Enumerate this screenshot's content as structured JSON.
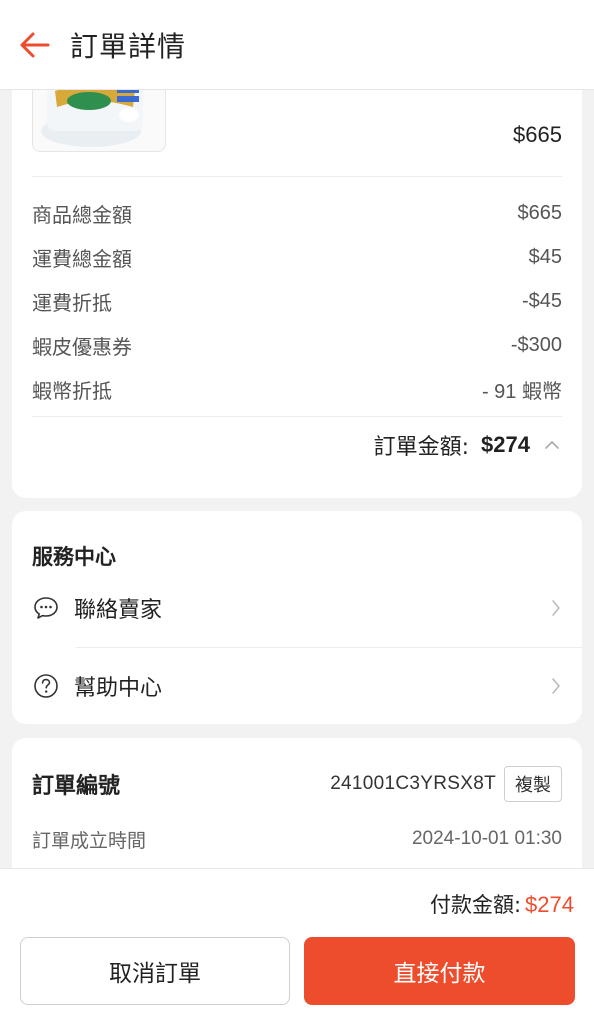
{
  "header": {
    "title": "訂單詳情"
  },
  "product": {
    "price": "$665"
  },
  "summary": {
    "rows": [
      {
        "label": "商品總金額",
        "value": "$665"
      },
      {
        "label": "運費總金額",
        "value": "$45"
      },
      {
        "label": "運費折抵",
        "value": "-$45"
      },
      {
        "label": "蝦皮優惠券",
        "value": "-$300"
      },
      {
        "label": "蝦幣折抵",
        "value": "- 91 蝦幣"
      }
    ],
    "total_label": "訂單金額:",
    "total_value": "$274"
  },
  "service": {
    "title": "服務中心",
    "items": [
      {
        "label": "聯絡賣家",
        "icon": "chat-bubble-icon"
      },
      {
        "label": "幫助中心",
        "icon": "help-circle-icon"
      }
    ]
  },
  "order": {
    "id_label": "訂單編號",
    "id_value": "241001C3YRSX8T",
    "copy_label": "複製",
    "time_label": "訂單成立時間",
    "time_value": "2024-10-01 01:30"
  },
  "footer": {
    "pay_label": "付款金額:",
    "pay_value": "$274",
    "cancel_label": "取消訂單",
    "pay_button_label": "直接付款"
  },
  "colors": {
    "accent": "#ee4d2d",
    "background": "#f2f2f2"
  }
}
